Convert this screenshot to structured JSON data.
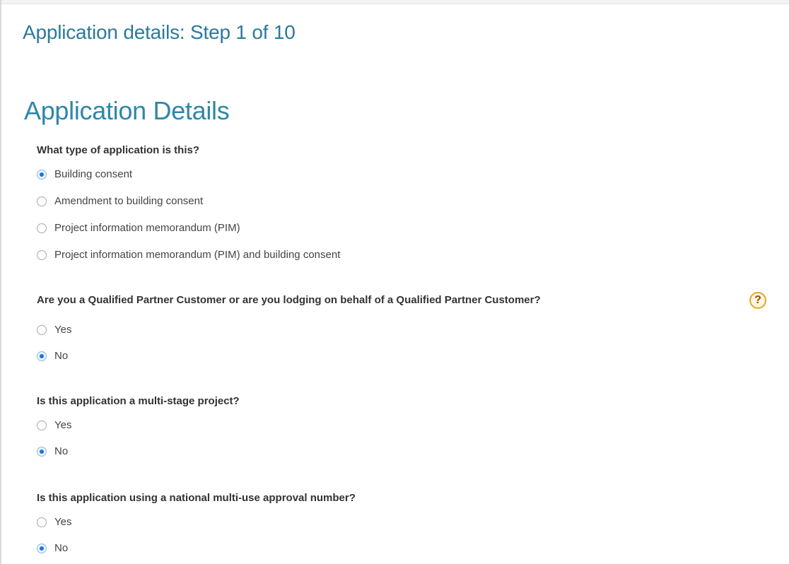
{
  "header": {
    "step_title": "Application details: Step 1 of 10"
  },
  "section": {
    "title": "Application Details"
  },
  "questions": [
    {
      "label": "What type of application is this?",
      "options": [
        {
          "label": "Building consent",
          "selected": true
        },
        {
          "label": "Amendment to building consent",
          "selected": false
        },
        {
          "label": "Project information memorandum (PIM)",
          "selected": false
        },
        {
          "label": "Project information memorandum (PIM) and building consent",
          "selected": false
        }
      ]
    },
    {
      "label": "Are you a Qualified Partner Customer or are you lodging on behalf of a Qualified Partner Customer?",
      "help_icon": "?",
      "options": [
        {
          "label": "Yes",
          "selected": false
        },
        {
          "label": "No",
          "selected": true
        }
      ]
    },
    {
      "label": "Is this application a multi-stage project?",
      "options": [
        {
          "label": "Yes",
          "selected": false
        },
        {
          "label": "No",
          "selected": true
        }
      ]
    },
    {
      "label": "Is this application using a national multi-use approval number?",
      "options": [
        {
          "label": "Yes",
          "selected": false
        },
        {
          "label": "No",
          "selected": true
        }
      ]
    }
  ],
  "colors": {
    "heading": "#2b7a9b",
    "radio_selected": "#1a73e8",
    "help_icon_border": "#e0a62e"
  },
  "icons": {
    "help": "question-circle-icon",
    "radio": "radio-button-icon"
  }
}
